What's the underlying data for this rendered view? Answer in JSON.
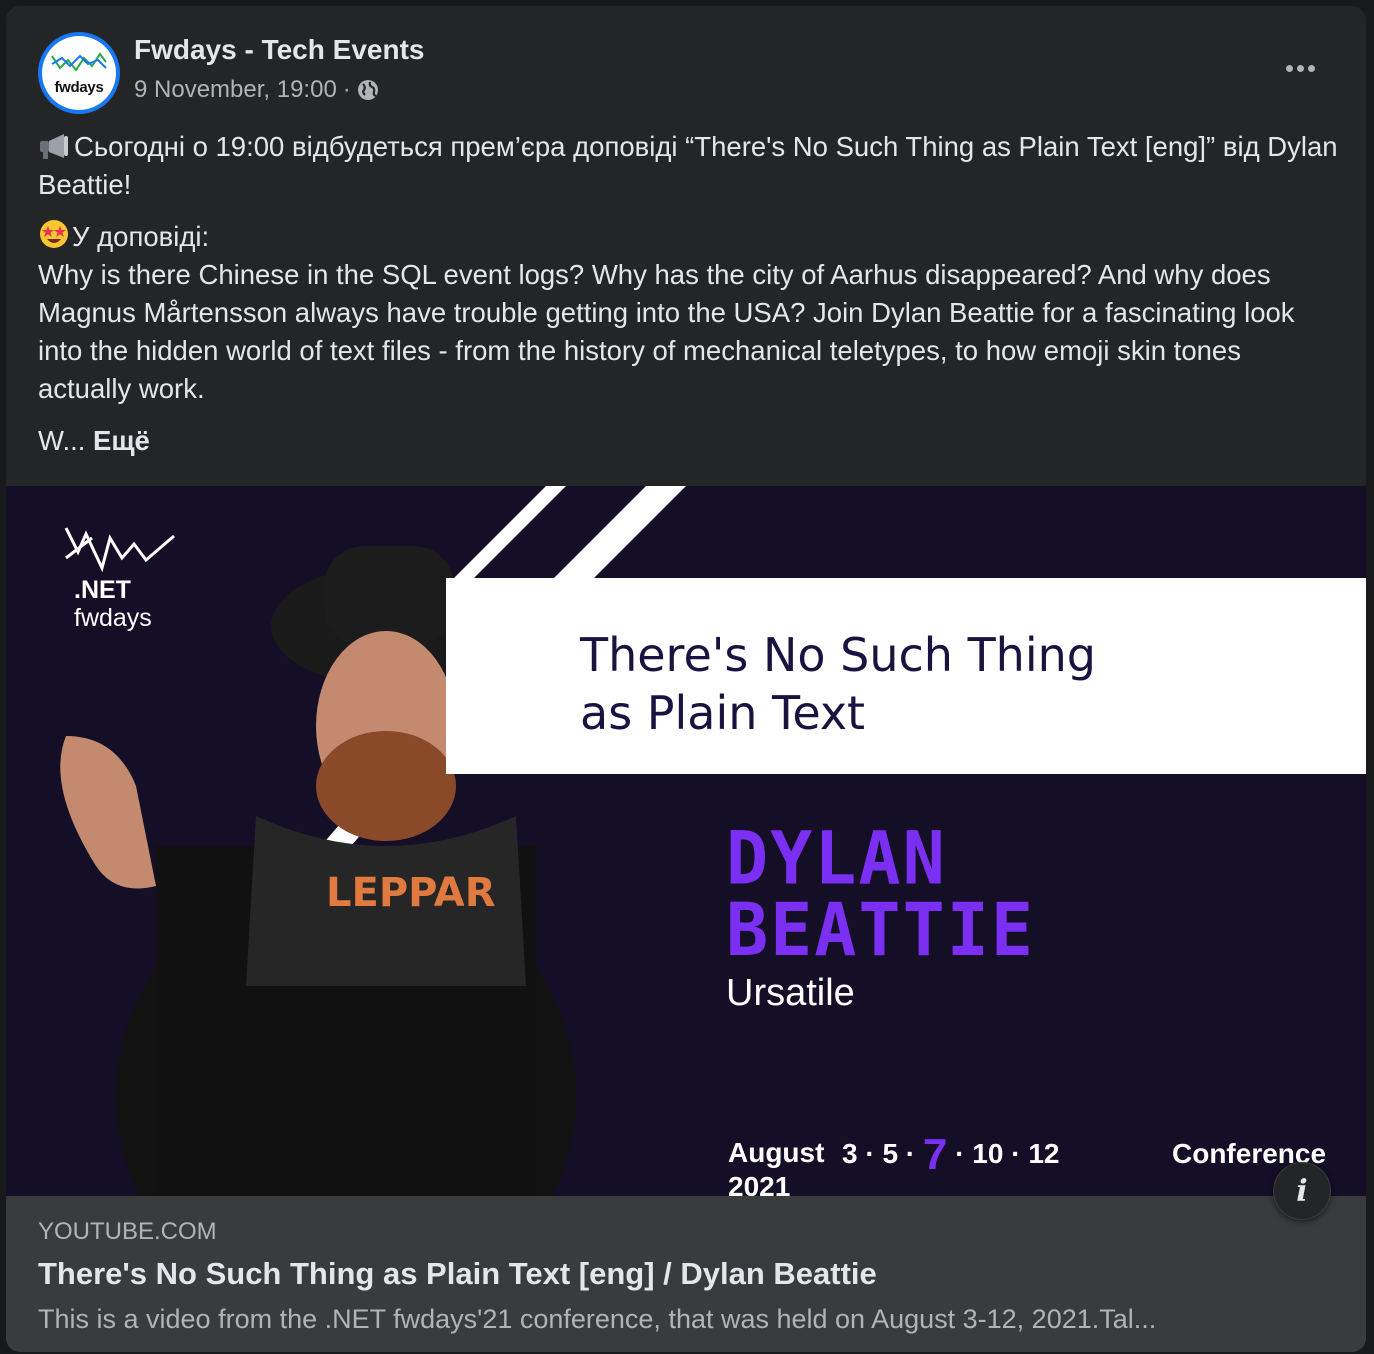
{
  "post": {
    "page_name": "Fwdays - Tech Events",
    "avatar_text": "fwdays",
    "timestamp": "9 November, 19:00",
    "separator": "·",
    "privacy_icon": "globe-icon",
    "more_icon": "more-options-icon",
    "text": {
      "line1_emoji": "loudspeaker-emoji",
      "line1": "Сьогодні о 19:00 відбудеться прем’єра доповіді “There's No Such Thing as Plain Text [eng]” від Dylan Beattie!",
      "line2_emoji": "star-struck-emoji",
      "line2_heading": "У доповіді:",
      "line2_body": "Why is there Chinese in the SQL event logs? Why has the city of Aarhus disappeared? And why does Magnus Mårtensson always have trouble getting into the USA? Join Dylan Beattie for a fascinating look into the hidden world of text files - from the history of mechanical teletypes, to how emoji skin tones actually work.",
      "truncated": "W...",
      "see_more": "Ещё"
    }
  },
  "media": {
    "logo_line1": ".NET",
    "logo_line2": "fwdays",
    "banner_title_line1": "There's No Such Thing",
    "banner_title_line2": "as Plain Text",
    "speaker_first": "DYLAN",
    "speaker_last": "BEATTIE",
    "company": "Ursatile",
    "date_month": "August",
    "date_year": "2021",
    "days_a": "3 · 5 ·",
    "day_highlight": "7",
    "days_b": "· 10 · 12",
    "conference": "Conference",
    "info_icon": "i",
    "accent_color": "#7b2ff2"
  },
  "link": {
    "domain": "YOUTUBE.COM",
    "title": "There's No Such Thing as Plain Text [eng] / Dylan Beattie",
    "description": "This is a video from the .NET fwdays'21 conference, that was held on August 3-12, 2021.Tal..."
  }
}
